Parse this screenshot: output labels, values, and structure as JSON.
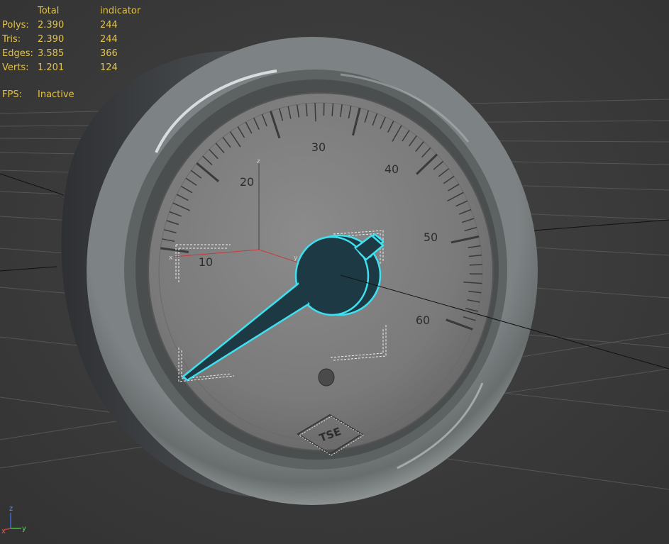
{
  "stats": {
    "headers": {
      "total": "Total",
      "object": "indicator"
    },
    "rows": [
      {
        "label": "Polys:",
        "total": "2.390",
        "object": "244"
      },
      {
        "label": "Tris:",
        "total": "2.390",
        "object": "244"
      },
      {
        "label": "Edges:",
        "total": "3.585",
        "object": "366"
      },
      {
        "label": "Verts:",
        "total": "1.201",
        "object": "124"
      }
    ],
    "fps_label": "FPS:",
    "fps_value": "Inactive"
  },
  "gauge": {
    "scale_labels": [
      "10",
      "20",
      "30",
      "40",
      "50",
      "60"
    ],
    "brand_logo": "TSE",
    "needle_color": "#1d3a44",
    "selection_color": "#3fe0f0"
  },
  "gizmo": {
    "x": "x",
    "y": "y",
    "z": "z"
  },
  "axis_tripod": {
    "x": "x",
    "y": "y",
    "z": "z"
  },
  "colors": {
    "stats_text": "#e2c24a",
    "viewport_bg": "#3a3a3a",
    "grid_line": "#555555"
  }
}
